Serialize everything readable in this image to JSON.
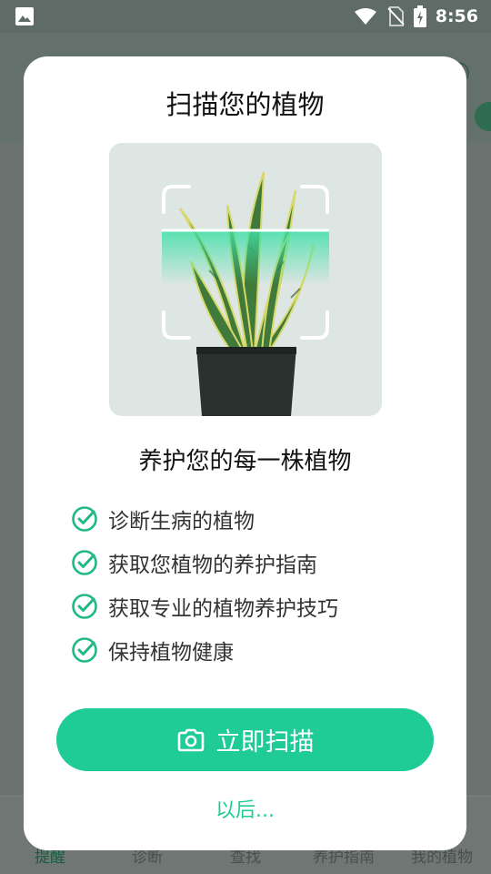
{
  "status_bar": {
    "time": "8:56",
    "icons": [
      "image-icon",
      "wifi-icon",
      "no-sim-icon",
      "battery-charging-icon"
    ]
  },
  "background": {
    "bottom_nav": [
      {
        "label": "提醒",
        "active": true
      },
      {
        "label": "诊断",
        "active": false
      },
      {
        "label": "查找",
        "active": false
      },
      {
        "label": "养护指南",
        "active": false
      },
      {
        "label": "我的植物",
        "active": false
      }
    ]
  },
  "modal": {
    "title": "扫描您的植物",
    "subtitle": "养护您的每一株植物",
    "features": [
      "诊断生病的植物",
      "获取您植物的养护指南",
      "获取专业的植物养护技巧",
      "保持植物健康"
    ],
    "scan_button_label": "立即扫描",
    "later_label": "以后..."
  },
  "colors": {
    "accent": "#1fcc96",
    "check": "#1fb886"
  }
}
